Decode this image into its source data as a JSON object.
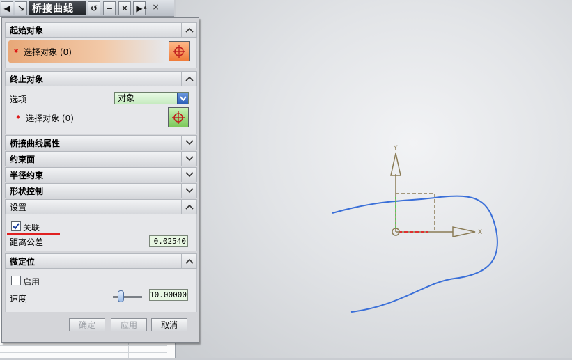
{
  "toolbar": {
    "title": "桥接曲线",
    "collapse_glyph": "▴",
    "close_glyph": "×"
  },
  "dialog": {
    "start_section": {
      "header": "起始对象",
      "select_label": "选择对象 (0)",
      "required_mark": "*"
    },
    "end_section": {
      "header": "终止对象",
      "option_label": "选项",
      "option_value": "对象",
      "select_label": "选择对象 (0)",
      "required_mark": "*"
    },
    "collapsed_sections": [
      "桥接曲线属性",
      "约束面",
      "半径约束",
      "形状控制"
    ],
    "settings_section": {
      "header": "设置",
      "associative_label": "关联",
      "associative_checked": true,
      "tolerance_label": "距离公差",
      "tolerance_value": "0.02540"
    },
    "fine_section": {
      "header": "微定位",
      "enable_label": "启用",
      "enable_checked": false,
      "speed_label": "速度",
      "speed_value": "10.00000",
      "slider_level": 0.25
    },
    "buttons": {
      "ok": "确定",
      "apply": "应用",
      "cancel": "取消"
    }
  },
  "viewport": {
    "axis_x_label": "X",
    "axis_y_label": "Y",
    "curve_color": "#3a6fd8",
    "annotation_color": "#e03030"
  }
}
